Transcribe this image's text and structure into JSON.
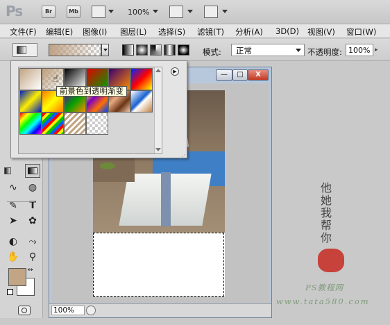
{
  "app": {
    "logo": "Ps",
    "bridge_label": "Br",
    "minibridge_label": "Mb",
    "zoom": "100%"
  },
  "menu": [
    "文件(F)",
    "编辑(E)",
    "图像(I)",
    "图层(L)",
    "选择(S)",
    "滤镜(T)",
    "分析(A)",
    "3D(D)",
    "视图(V)",
    "窗口(W)"
  ],
  "options": {
    "mode_label": "模式:",
    "mode_value": "正常",
    "opacity_label": "不透明度:",
    "opacity_value": "100%",
    "gradient_types": [
      "linear",
      "radial",
      "angle",
      "reflected",
      "diamond"
    ]
  },
  "picker": {
    "tooltip": "前景色到透明渐变",
    "swatches": [
      {
        "name": "foreground-to-background"
      },
      {
        "name": "foreground-to-transparent"
      },
      {
        "name": "black-white"
      },
      {
        "name": "red-green"
      },
      {
        "name": "violet-orange"
      },
      {
        "name": "blue-red-yellow"
      },
      {
        "name": "blue-yellow-blue"
      },
      {
        "name": "orange-yellow-orange"
      },
      {
        "name": "violet-green-orange"
      },
      {
        "name": "yellow-violet-orange-blue"
      },
      {
        "name": "copper"
      },
      {
        "name": "chrome"
      },
      {
        "name": "spectrum"
      },
      {
        "name": "transparent-rainbow"
      },
      {
        "name": "transparent-stripes"
      },
      {
        "name": "transparent"
      }
    ]
  },
  "document": {
    "title_suffix": "*",
    "zoom": "100%"
  },
  "window_controls": {
    "minimize": "—",
    "restore": "□",
    "close": "X"
  },
  "watermark": {
    "calligraphy": "他她我帮你",
    "line1": "PS教程网",
    "line2": "www.tata580.com"
  }
}
